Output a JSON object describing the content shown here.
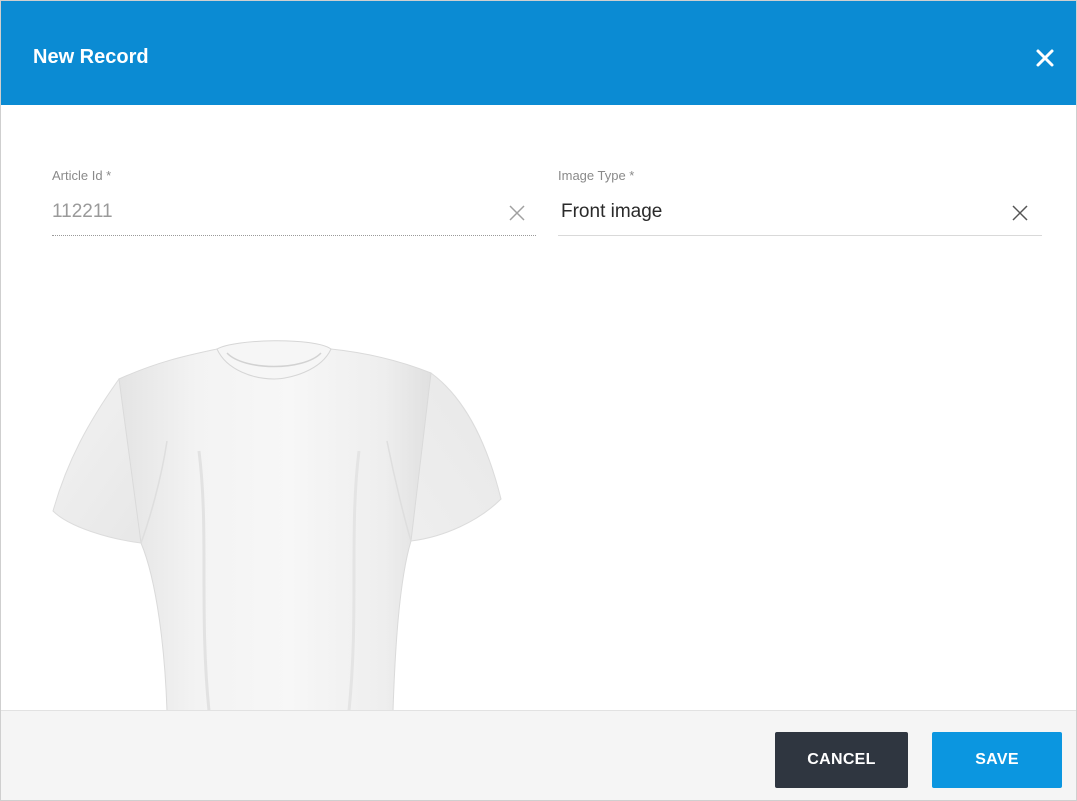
{
  "dialog": {
    "title": "New Record",
    "header_color": "#0b8bd3",
    "close_icon": "close-icon"
  },
  "fields": {
    "article_id": {
      "label": "Article Id *",
      "value": "112211",
      "clear_icon": "clear-icon",
      "disabled": true
    },
    "image_type": {
      "label": "Image Type *",
      "value": "Front image",
      "clear_icon": "clear-icon"
    }
  },
  "preview": {
    "subject": "white t-shirt"
  },
  "footer": {
    "cancel_label": "CANCEL",
    "save_label": "SAVE",
    "cancel_color": "#2f3640",
    "save_color": "#0b96e0"
  }
}
